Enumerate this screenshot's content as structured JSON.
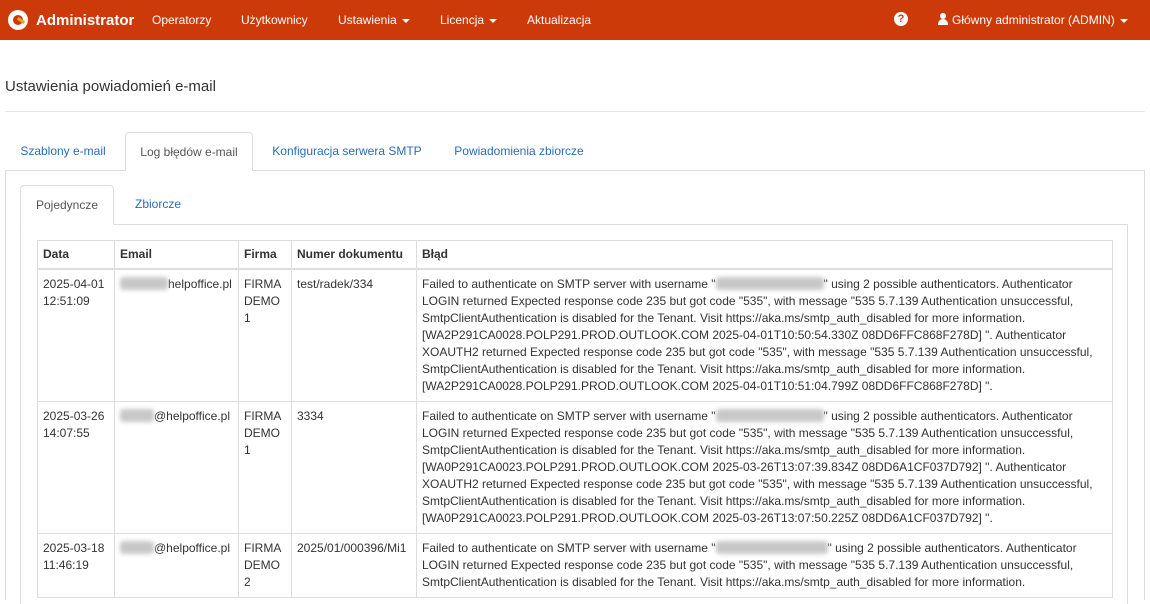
{
  "navbar": {
    "brand": "Administrator",
    "items": [
      {
        "label": "Operatorzy"
      },
      {
        "label": "Użytkownicy"
      },
      {
        "label": "Ustawienia"
      },
      {
        "label": "Licencja"
      },
      {
        "label": "Aktualizacja"
      }
    ],
    "help_icon": "?",
    "user": "Główny administrator (ADMIN)"
  },
  "page": {
    "title": "Ustawienia powiadomień e-mail"
  },
  "tabs_main": [
    {
      "label": "Szablony e-mail"
    },
    {
      "label": "Log błędów e-mail"
    },
    {
      "label": "Konfiguracja serwera SMTP"
    },
    {
      "label": "Powiadomienia zbiorcze"
    }
  ],
  "tabs_sub": [
    {
      "label": "Pojedyncze"
    },
    {
      "label": "Zbiorcze"
    }
  ],
  "table": {
    "headers": [
      "Data",
      "Email",
      "Firma",
      "Numer dokumentu",
      "Błąd"
    ],
    "rows": [
      {
        "date": "2025-04-01",
        "time": "12:51:09",
        "email_domain": "helpoffice.pl",
        "firm1": "FIRMA",
        "firm2": "DEMO",
        "firm3": "1",
        "doc": "test/radek/334",
        "err_a": "Failed to authenticate on SMTP server with username \"",
        "err_b": "\" using 2 possible authenticators. Authenticator LOGIN returned Expected response code 235 but got code \"535\", with message \"535 5.7.139 Authentication unsuccessful, SmtpClientAuthentication is disabled for the Tenant. Visit https://aka.ms/smtp_auth_disabled for more information. [WA2P291CA0028.POLP291.PROD.OUTLOOK.COM 2025-04-01T10:50:54.330Z 08DD6FFC868F278D] \". Authenticator XOAUTH2 returned Expected response code 235 but got code \"535\", with message \"535 5.7.139 Authentication unsuccessful, SmtpClientAuthentication is disabled for the Tenant. Visit https://aka.ms/smtp_auth_disabled for more information. [WA2P291CA0028.POLP291.PROD.OUTLOOK.COM 2025-04-01T10:51:04.799Z 08DD6FFC868F278D] \"."
      },
      {
        "date": "2025-03-26",
        "time": "14:07:55",
        "email_domain": "@helpoffice.pl",
        "firm1": "FIRMA",
        "firm2": "DEMO",
        "firm3": "1",
        "doc": "3334",
        "err_a": "Failed to authenticate on SMTP server with username \"",
        "err_b": "\" using 2 possible authenticators. Authenticator LOGIN returned Expected response code 235 but got code \"535\", with message \"535 5.7.139 Authentication unsuccessful, SmtpClientAuthentication is disabled for the Tenant. Visit https://aka.ms/smtp_auth_disabled for more information. [WA0P291CA0023.POLP291.PROD.OUTLOOK.COM 2025-03-26T13:07:39.834Z 08DD6A1CF037D792] \". Authenticator XOAUTH2 returned Expected response code 235 but got code \"535\", with message \"535 5.7.139 Authentication unsuccessful, SmtpClientAuthentication is disabled for the Tenant. Visit https://aka.ms/smtp_auth_disabled for more information. [WA0P291CA0023.POLP291.PROD.OUTLOOK.COM 2025-03-26T13:07:50.225Z 08DD6A1CF037D792] \"."
      },
      {
        "date": "2025-03-18",
        "time": "11:46:19",
        "email_domain": "@helpoffice.pl",
        "firm1": "FIRMA",
        "firm2": "DEMO",
        "firm3": "2",
        "doc": "2025/01/000396/Mi1",
        "err_a": "Failed to authenticate on SMTP server with username \"",
        "err_b": "\" using 2 possible authenticators. Authenticator LOGIN returned Expected response code 235 but got code \"535\", with message \"535 5.7.139 Authentication unsuccessful, SmtpClientAuthentication is disabled for the Tenant. Visit https://aka.ms/smtp_auth_disabled for more information."
      }
    ]
  },
  "colors": {
    "navbar": "#cc3a0a",
    "link": "#2a6cb8",
    "border": "#dddddd"
  }
}
